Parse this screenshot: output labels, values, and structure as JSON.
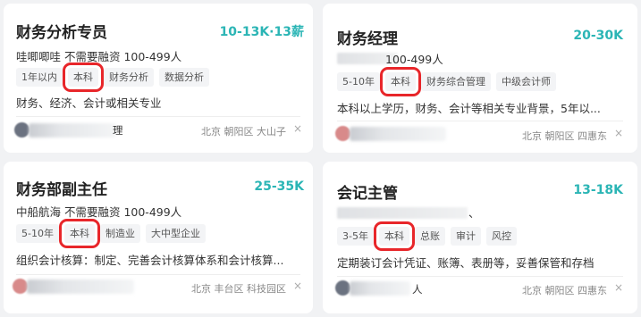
{
  "jobs": [
    {
      "title": "财务分析专员",
      "salary": "10-13K·13薪",
      "company_line": "哇唧唧哇 不需要融资 100-499人",
      "tags": [
        "1年以内",
        "本科",
        "财务分析",
        "数据分析"
      ],
      "description": "财务、经济、会计或相关专业",
      "recruiter_visible": "理",
      "location": "北京 朝阳区 大山子"
    },
    {
      "title": "财务经理",
      "salary": "20-30K",
      "company_line": "100-499人",
      "tags": [
        "5-10年",
        "本科",
        "财务综合管理",
        "中级会计师"
      ],
      "description": "本科以上学历，财务、会计等相关专业背景，5年以...",
      "recruiter_visible": "",
      "location": "北京 朝阳区 四惠东"
    },
    {
      "title": "财务部副主任",
      "salary": "25-35K",
      "company_line": "中船航海 不需要融资 100-499人",
      "tags": [
        "5-10年",
        "本科",
        "制造业",
        "大中型企业"
      ],
      "description": "组织会计核算：制定、完善会计核算体系和会计核算...",
      "recruiter_visible": "",
      "location": "北京 丰台区 科技园区"
    },
    {
      "title": "会记主管",
      "salary": "13-18K",
      "company_line": "、",
      "tags": [
        "3-5年",
        "本科",
        "总账",
        "审计",
        "风控"
      ],
      "description": "定期装订会计凭证、账簿、表册等，妥善保管和存档",
      "recruiter_visible": "人",
      "location": "北京 朝阳区 四惠东"
    }
  ],
  "close_symbol": "×",
  "colors": {
    "salary": "#2bb5b5",
    "highlight_box": "#e8262a",
    "background": "#f1f2f4"
  }
}
